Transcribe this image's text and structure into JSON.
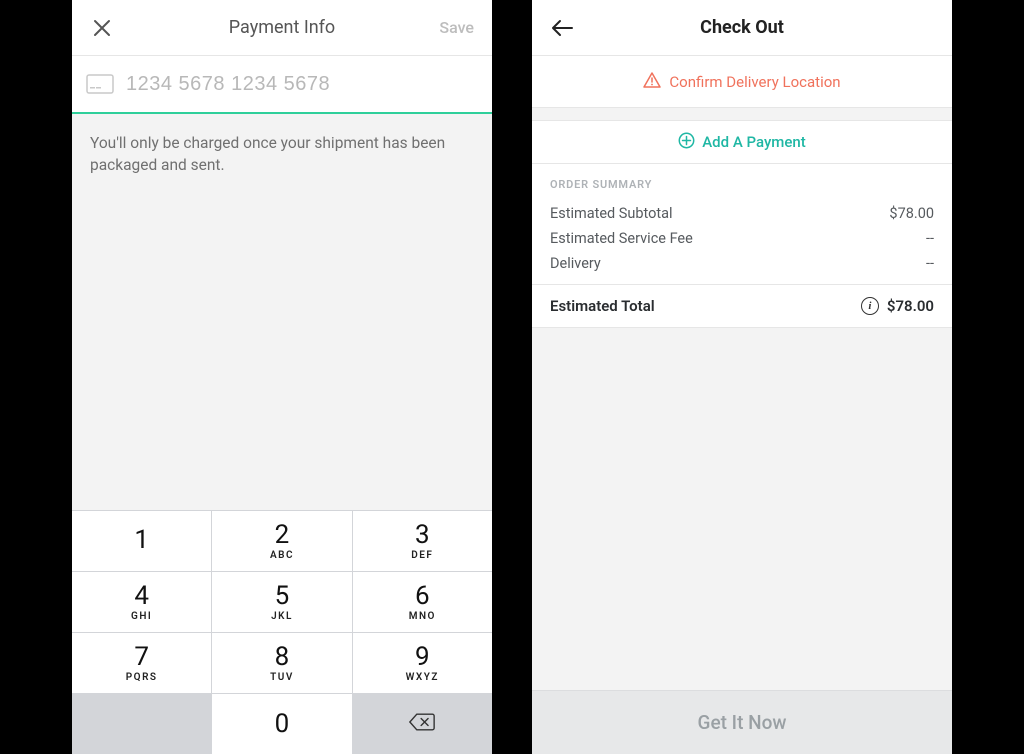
{
  "left": {
    "header": {
      "title": "Payment Info",
      "save": "Save"
    },
    "card_placeholder": "1234 5678 1234 5678",
    "card_value": "",
    "info": "You'll only be charged once your shipment has been packaged and sent.",
    "keypad": [
      {
        "d": "1",
        "s": ""
      },
      {
        "d": "2",
        "s": "ABC"
      },
      {
        "d": "3",
        "s": "DEF"
      },
      {
        "d": "4",
        "s": "GHI"
      },
      {
        "d": "5",
        "s": "JKL"
      },
      {
        "d": "6",
        "s": "MNO"
      },
      {
        "d": "7",
        "s": "PQRS"
      },
      {
        "d": "8",
        "s": "TUV"
      },
      {
        "d": "9",
        "s": "WXYZ"
      }
    ],
    "zero": "0"
  },
  "right": {
    "header": {
      "title": "Check Out"
    },
    "confirm_location": "Confirm Delivery Location",
    "add_payment": "Add A Payment",
    "summary_head": "ORDER SUMMARY",
    "lines": {
      "subtotal_label": "Estimated Subtotal",
      "subtotal_value": "$78.00",
      "fee_label": "Estimated Service Fee",
      "fee_value": "--",
      "delivery_label": "Delivery",
      "delivery_value": "--"
    },
    "total_label": "Estimated Total",
    "total_value": "$78.00",
    "cta": "Get It Now"
  }
}
